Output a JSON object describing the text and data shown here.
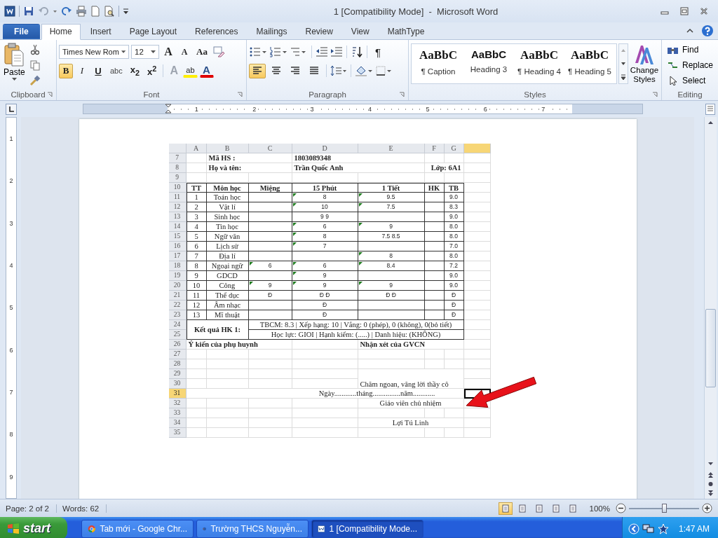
{
  "title_bar": {
    "title": "1 [Compatibility Mode]  -  Microsoft Word"
  },
  "tabs": [
    {
      "label": "File",
      "kind": "file",
      "selected": false
    },
    {
      "label": "Home",
      "kind": "tab",
      "selected": true
    },
    {
      "label": "Insert",
      "kind": "tab",
      "selected": false
    },
    {
      "label": "Page Layout",
      "kind": "tab",
      "selected": false
    },
    {
      "label": "References",
      "kind": "tab",
      "selected": false
    },
    {
      "label": "Mailings",
      "kind": "tab",
      "selected": false
    },
    {
      "label": "Review",
      "kind": "tab",
      "selected": false
    },
    {
      "label": "View",
      "kind": "tab",
      "selected": false
    },
    {
      "label": "MathType",
      "kind": "tab",
      "selected": false
    }
  ],
  "ribbon": {
    "clipboard": {
      "paste": "Paste",
      "label": "Clipboard"
    },
    "font": {
      "name": "Times New Rom",
      "size": "12",
      "grow": "A",
      "shrink": "A",
      "case": "Aa",
      "effects": "A",
      "highlight": "ab",
      "font_color": "A",
      "label": "Font",
      "format_buttons": [
        {
          "label": "B",
          "kind": "bold",
          "selected": true
        },
        {
          "label": "I",
          "kind": "italic",
          "selected": false
        },
        {
          "label": "U",
          "kind": "underline",
          "selected": false
        },
        {
          "label": "abc",
          "kind": "strike",
          "selected": false
        },
        {
          "label": "x$_{2}$",
          "kind": "sub",
          "selected": false
        },
        {
          "label": "x$^{2}$",
          "kind": "sup",
          "selected": false
        }
      ]
    },
    "paragraph": {
      "label": "Paragraph",
      "pilcrow": "¶",
      "alignments": [
        {
          "kind": "left",
          "selected": true
        },
        {
          "kind": "center",
          "selected": false
        },
        {
          "kind": "right",
          "selected": false
        },
        {
          "kind": "justify",
          "selected": false
        }
      ]
    },
    "styles": {
      "label": "Styles",
      "change_styles": "Change Styles",
      "gallery": [
        {
          "sample": "AaBbC",
          "name": "¶ Caption",
          "kind": "caption"
        },
        {
          "sample": "AaBbC",
          "name": "Heading 3",
          "kind": "heading"
        },
        {
          "sample": "AaBbC",
          "name": "¶ Heading 4",
          "kind": "caption"
        },
        {
          "sample": "AaBbC",
          "name": "¶ Heading 5",
          "kind": "caption"
        }
      ]
    },
    "editing": {
      "label": "Editing",
      "items": [
        {
          "label": "Find",
          "kind": "find"
        },
        {
          "label": "Replace",
          "kind": "replace"
        },
        {
          "label": "Select",
          "kind": "select"
        }
      ]
    }
  },
  "ruler": {
    "numbers": [
      "1",
      "2",
      "3",
      "4",
      "5",
      "6",
      "7"
    ]
  },
  "vertical_ruler": {
    "numbers": [
      "1",
      "2",
      "3",
      "4",
      "5",
      "6",
      "7",
      "8",
      "9"
    ]
  },
  "spreadsheet": {
    "columns": [
      "A",
      "B",
      "C",
      "D",
      "E",
      "F",
      "G"
    ],
    "rows": [
      {
        "kind": "info",
        "n": "7",
        "selected": false,
        "label": "Mã HS :",
        "value": "1803089348"
      },
      {
        "kind": "info",
        "n": "8",
        "selected": false,
        "label": "Họ và tên:",
        "value": "Trần Quốc Anh",
        "class": "Lớp: 6A1"
      },
      {
        "kind": "blank",
        "n": "9",
        "selected": false
      },
      {
        "kind": "head",
        "n": "10",
        "selected": false,
        "cells": [
          "TT",
          "Môn học",
          "Miệng",
          "15 Phút",
          "1 Tiết",
          "HK",
          "TB"
        ]
      },
      {
        "kind": "grade",
        "n": "11",
        "selected": false,
        "tt": "1",
        "subject": "Toán học",
        "p15": {
          "text": "8",
          "flag": true
        },
        "tiet": {
          "text": "9.5",
          "flag": true
        },
        "tb": "9.0"
      },
      {
        "kind": "grade",
        "n": "12",
        "selected": false,
        "tt": "2",
        "subject": "Vật lí",
        "p15": {
          "text": "10",
          "flag": true
        },
        "tiet": {
          "text": "7.5",
          "flag": true
        },
        "tb": "8.3"
      },
      {
        "kind": "grade",
        "n": "13",
        "selected": false,
        "tt": "3",
        "subject": "Sinh học",
        "p15": {
          "text": "9 9",
          "flag": false
        },
        "tb": "9.0"
      },
      {
        "kind": "grade",
        "n": "14",
        "selected": false,
        "tt": "4",
        "subject": "Tin học",
        "p15": {
          "text": "6",
          "flag": true
        },
        "tiet": {
          "text": "9",
          "flag": true
        },
        "tb": "8.0"
      },
      {
        "kind": "grade",
        "n": "15",
        "selected": false,
        "tt": "5",
        "subject": "Ngữ văn",
        "p15": {
          "text": "8",
          "flag": true
        },
        "tiet": {
          "text": "7.5 8.5",
          "flag": false
        },
        "tb": "8.0"
      },
      {
        "kind": "grade",
        "n": "16",
        "selected": false,
        "tt": "6",
        "subject": "Lịch sử",
        "p15": {
          "text": "7",
          "flag": true
        },
        "tb": "7.0"
      },
      {
        "kind": "grade",
        "n": "17",
        "selected": false,
        "tt": "7",
        "subject": "Địa lí",
        "tiet": {
          "text": "8",
          "flag": true
        },
        "tb": "8.0"
      },
      {
        "kind": "grade",
        "n": "18",
        "selected": false,
        "tt": "8",
        "subject": "Ngoại ngữ",
        "mieng": {
          "text": "6",
          "flag": true
        },
        "p15": {
          "text": "6",
          "flag": true
        },
        "tiet": {
          "text": "8.4",
          "flag": true
        },
        "tb": "7.2"
      },
      {
        "kind": "grade",
        "n": "19",
        "selected": false,
        "tt": "9",
        "subject": "GDCD",
        "p15": {
          "text": "9",
          "flag": true
        },
        "tb": "9.0"
      },
      {
        "kind": "grade",
        "n": "20",
        "selected": false,
        "tt": "10",
        "subject": "Công",
        "mieng": {
          "text": "9",
          "flag": true
        },
        "p15": {
          "text": "9",
          "flag": true
        },
        "tiet": {
          "text": "9",
          "flag": true
        },
        "tb": "9.0"
      },
      {
        "kind": "grade",
        "n": "21",
        "selected": false,
        "tt": "11",
        "subject": "Thể dục",
        "mieng": {
          "text": "Đ",
          "flag": false
        },
        "p15": {
          "text": "Đ  Đ",
          "flag": false
        },
        "tiet": {
          "text": "Đ  Đ",
          "flag": false
        },
        "tb": "Đ"
      },
      {
        "kind": "grade",
        "n": "22",
        "selected": false,
        "tt": "12",
        "subject": "Âm nhạc",
        "p15": {
          "text": "Đ",
          "flag": false
        },
        "tb": "Đ"
      },
      {
        "kind": "grade",
        "n": "23",
        "selected": false,
        "tt": "13",
        "subject": "Mĩ thuật",
        "p15": {
          "text": "Đ",
          "flag": false
        },
        "tb": "Đ"
      },
      {
        "kind": "summary",
        "numbers": [
          "24",
          "25"
        ],
        "selected": false,
        "label": "Kết quả HK 1:",
        "lines": [
          "TBCM: 8.3 | Xếp hạng: 10 | Vắng: 0 (phép), 0 (không), 0(bỏ tiết)",
          "Học lực: GIOI | Hạnh kiểm: (.....) | Danh hiệu: (KHÔNG)"
        ]
      },
      {
        "kind": "comments",
        "n": "26",
        "selected": false,
        "left": "Ý kiến của phụ huynh",
        "right": "Nhận xét của GVCN"
      },
      {
        "kind": "blank",
        "n": "27",
        "selected": false
      },
      {
        "kind": "blank",
        "n": "28",
        "selected": false
      },
      {
        "kind": "note",
        "numbers": [
          "29",
          "30"
        ],
        "selected": false,
        "text": "Chăm ngoan, vâng lời thầy cô"
      },
      {
        "kind": "date",
        "n": "31",
        "selected": true,
        "text": "Ngày............tháng...............năm............"
      },
      {
        "kind": "sign",
        "n": "32",
        "selected": false,
        "text": "Giáo viên chủ nhiệm"
      },
      {
        "kind": "blank",
        "n": "33",
        "selected": false
      },
      {
        "kind": "sign",
        "n": "34",
        "selected": false,
        "text": "Lợi Tú Linh"
      },
      {
        "kind": "blank",
        "n": "35",
        "selected": false
      }
    ]
  },
  "status_bar": {
    "page": "Page: 2 of 2",
    "words": "Words: 62",
    "views": [
      {
        "selected": true
      },
      {
        "selected": false
      },
      {
        "selected": false
      },
      {
        "selected": false
      },
      {
        "selected": false
      }
    ],
    "zoom": "100%",
    "zoom_slider": {
      "level": 0.5
    }
  },
  "taskbar": {
    "start": "start",
    "items": [
      {
        "label": "Tab mới - Google Chr...",
        "kind": "chrome",
        "selected": false
      },
      {
        "label": "Trường THCS Nguyễn...",
        "kind": "firefox",
        "selected": false
      },
      {
        "label": "1 [Compatibility Mode...",
        "kind": "word",
        "selected": true
      }
    ],
    "clock": "1:47 AM"
  }
}
